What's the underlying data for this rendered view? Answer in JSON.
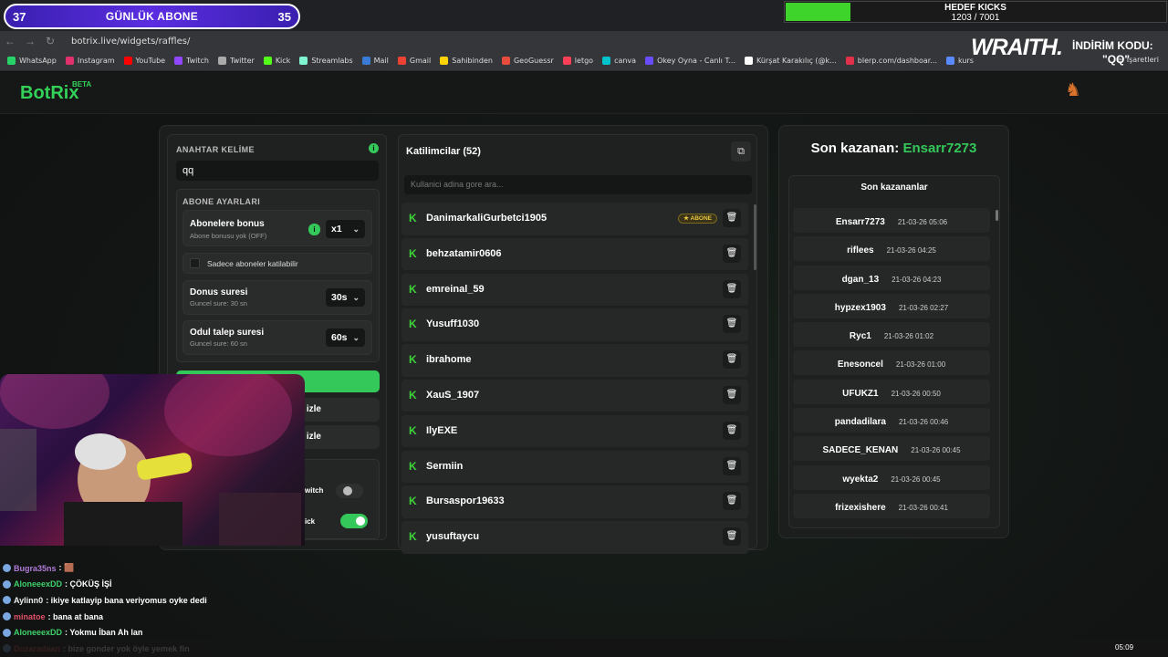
{
  "overlay": {
    "sub_left": "37",
    "sub_label": "GÜNLÜK ABONE",
    "sub_right": "35",
    "goal_title": "HEDEF KICKS",
    "goal_count": "1203 / 7001",
    "goal_fraction": 0.17,
    "sponsor": "WRAITH.",
    "code_label": "İNDİRİM KODU:",
    "code_value": "\"QQ\""
  },
  "browser": {
    "url": "botrix.live/widgets/raffles/",
    "bookmarks": [
      "WhatsApp",
      "Instagram",
      "YouTube",
      "Twitch",
      "Twitter",
      "Kick",
      "Streamlabs",
      "Mail",
      "Gmail",
      "Sahibinden",
      "GeoGuessr",
      "letgo",
      "canva",
      "Okey Oyna - Canlı T...",
      "Kürşat Karakılıç (@k...",
      "blerp.com/dashboar...",
      "kurs"
    ],
    "bookmarks_right": "er İşaretleri"
  },
  "site": {
    "logo": "BotRix",
    "beta": "BETA"
  },
  "settings": {
    "keyword_label": "ANAHTAR KELİME",
    "keyword_value": "qq",
    "sub_settings_label": "ABONE AYARLARI",
    "sub_bonus_title": "Abonelere bonus",
    "sub_bonus_sub": "Abone bonusu yok (OFF)",
    "sub_bonus_value": "x1",
    "only_subs": "Sadece aboneler katilabilir",
    "duration_title": "Donus suresi",
    "duration_sub": "Guncel sure: 30 sn",
    "duration_value": "30s",
    "claim_title": "Odul talep suresi",
    "claim_sub": "Guncel sure: 60 sn",
    "claim_value": "60s",
    "btn2_tail": "izle",
    "btn3_tail": "izle",
    "twitch_tail": "witch",
    "kick_tail": "ick"
  },
  "participants": {
    "header": "Katilimcilar (52)",
    "search_placeholder": "Kullanici adina gore ara...",
    "badge": "★ ABONE",
    "names": [
      "DanimarkaliGurbetci1905",
      "behzatamir0606",
      "emreinal_59",
      "Yusuff1030",
      "ibrahome",
      "XauS_1907",
      "IlyEXE",
      "Sermiin",
      "Bursaspor19633",
      "yusuftaycu"
    ]
  },
  "winners": {
    "last_label": "Son kazanan:",
    "last_name": "Ensarr7273",
    "list_title": "Son kazananlar",
    "rows": [
      {
        "name": "Ensarr7273",
        "date": "21-03-26 05:06"
      },
      {
        "name": "riflees",
        "date": "21-03-26 04:25"
      },
      {
        "name": "dgan_13",
        "date": "21-03-26 04:23"
      },
      {
        "name": "hypzex1903",
        "date": "21-03-26 02:27"
      },
      {
        "name": "Ryc1",
        "date": "21-03-26 01:02"
      },
      {
        "name": "Enesoncel",
        "date": "21-03-26 01:00"
      },
      {
        "name": "UFUKZ1",
        "date": "21-03-26 00:50"
      },
      {
        "name": "pandadilara",
        "date": "21-03-26 00:46"
      },
      {
        "name": "SADECE_KENAN",
        "date": "21-03-26 00:45"
      },
      {
        "name": "wyekta2",
        "date": "21-03-26 00:45"
      },
      {
        "name": "frizexishere",
        "date": "21-03-26 00:41"
      }
    ]
  },
  "chat": [
    {
      "user": "Bugra35ns",
      "color": "#b07ad8",
      "msg": ": 🟫"
    },
    {
      "user": "AloneeexDD",
      "color": "#3fd16a",
      "msg": ": ÇÖKÜŞ İŞİ"
    },
    {
      "user": "Aylinn0",
      "color": "#eeeeee",
      "msg": ": ikiye katlayip bana veriyomus oyke dedi"
    },
    {
      "user": "minatoe",
      "color": "#e0506a",
      "msg": ": bana at bana"
    },
    {
      "user": "AloneeexDD",
      "color": "#3fd16a",
      "msg": ": Yokmu İban Ah lan"
    },
    {
      "user": "Duzaradaan",
      "color": "#e05050",
      "msg": ": bize gonder yok öyle yemek fin"
    }
  ],
  "clock": "05:09"
}
